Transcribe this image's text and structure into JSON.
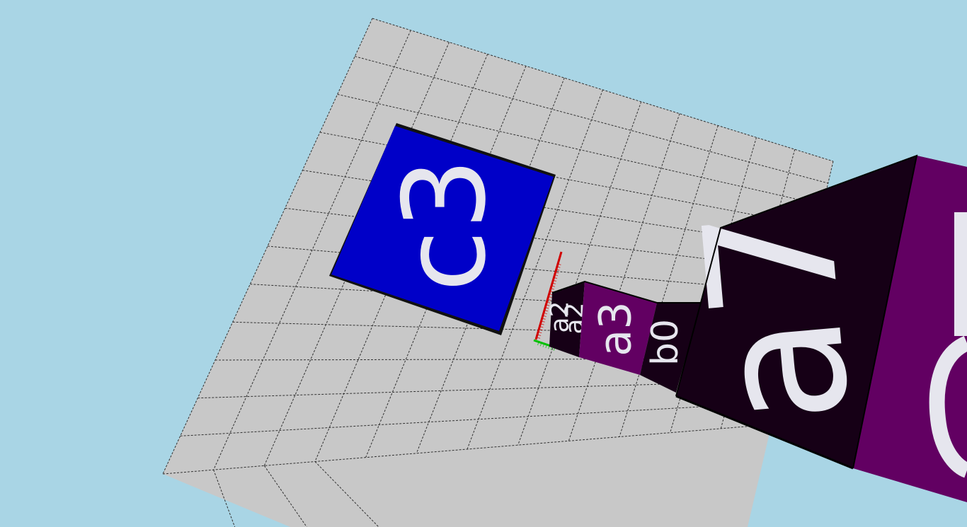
{
  "scene": {
    "colors": {
      "sky": "#a9d5e5",
      "floor": "#c8c8c8",
      "grid_line": "#333333",
      "tile_blue": "#0000c8",
      "cube_dark": "#160016",
      "cube_purple": "#620062",
      "glyph": "#e6e6ee",
      "axis_red": "#d00000",
      "axis_green": "#00c000"
    },
    "floor_tile": {
      "label": "c3"
    },
    "cubes": [
      {
        "top_label": "a2",
        "left_label": "a2",
        "front_label": "a3",
        "right_label": "b0"
      },
      {
        "front_label": "a7"
      }
    ],
    "axes": {
      "x_icon": "red-axis-arrow",
      "y_icon": "green-axis-arrow"
    }
  }
}
